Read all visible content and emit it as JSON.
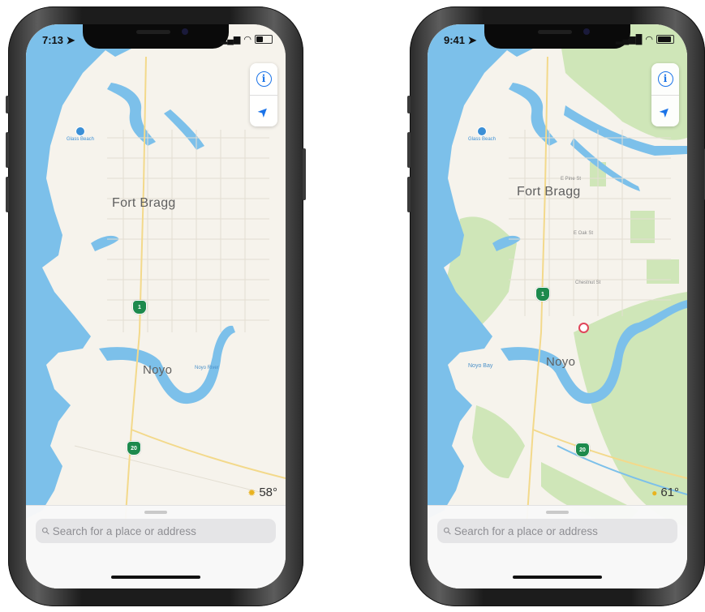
{
  "phones": [
    {
      "status": {
        "time": "7:13"
      },
      "map": {
        "city_label": "Fort Bragg",
        "town_label": "Noyo",
        "poi_label": "Glass Beach",
        "river_label": "Noyo River",
        "route_shield_1": "1",
        "route_shield_2": "20"
      },
      "weather": {
        "temp": "58°"
      },
      "search": {
        "placeholder": "Search for a place or address"
      }
    },
    {
      "status": {
        "time": "9:41"
      },
      "map": {
        "city_label": "Fort Bragg",
        "town_label": "Noyo",
        "poi_label": "Glass Beach",
        "bay_label": "Noyo Bay",
        "street_1": "E Pine St",
        "street_2": "E Oak St",
        "street_3": "Chestnut St",
        "route_shield_1": "1",
        "route_shield_2": "20"
      },
      "weather": {
        "temp": "61°"
      },
      "search": {
        "placeholder": "Search for a place or address"
      }
    }
  ],
  "colors": {
    "water": "#7cc0ea",
    "land": "#f6f3ec",
    "park": "#cfe6b8",
    "accent": "#1a73e8",
    "route_shield": "#1d8a4d"
  },
  "icons": [
    "location-arrow-icon",
    "wifi-icon",
    "signal-icon",
    "battery-icon",
    "info-icon",
    "navigate-icon",
    "search-icon",
    "sun-icon",
    "pin-icon"
  ]
}
